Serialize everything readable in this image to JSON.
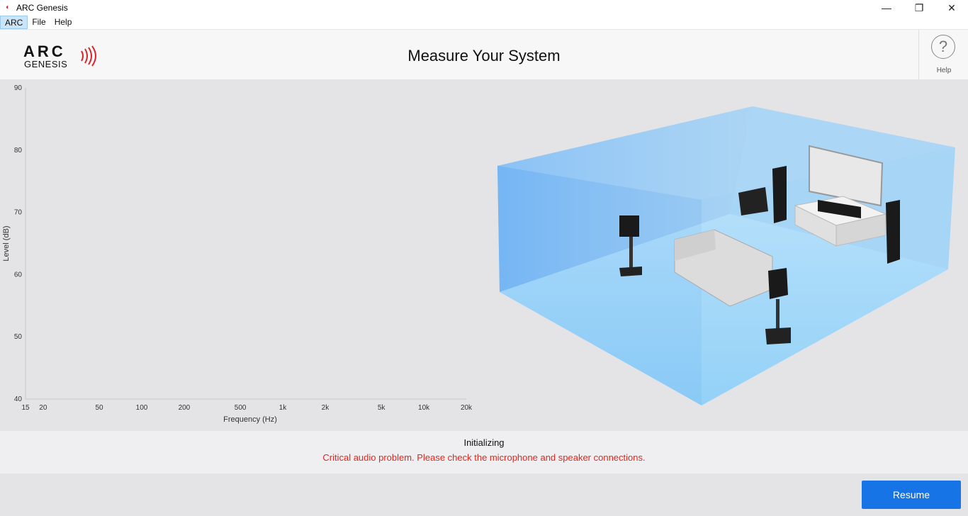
{
  "window": {
    "title": "ARC Genesis",
    "minimize": "—",
    "restore": "❐",
    "close": "✕"
  },
  "menu": {
    "items": [
      "ARC",
      "File",
      "Help"
    ]
  },
  "header": {
    "logo_top": "ARC",
    "logo_bottom": "GENESIS",
    "title": "Measure Your System",
    "help_symbol": "?",
    "help_label": "Help"
  },
  "colors": {
    "accent": "#1774e6",
    "error": "#e0261e",
    "room": "#6fb8f5"
  },
  "chart_data": {
    "type": "line",
    "title": "",
    "xlabel": "Frequency (Hz)",
    "ylabel": "Level (dB)",
    "xscale": "log",
    "xlim": [
      15,
      20000
    ],
    "ylim": [
      40,
      90
    ],
    "xticks": [
      15,
      20,
      50,
      100,
      200,
      500,
      1000,
      2000,
      5000,
      10000,
      20000
    ],
    "xtick_labels": [
      "15",
      "20",
      "50",
      "100",
      "200",
      "500",
      "1k",
      "2k",
      "5k",
      "10k",
      "20k"
    ],
    "yticks": [
      40,
      50,
      60,
      70,
      80,
      90
    ],
    "ytick_labels": [
      "40",
      "50",
      "60",
      "70",
      "80",
      "90"
    ],
    "grid": false,
    "series": []
  },
  "status": {
    "state": "Initializing",
    "error": "Critical audio problem. Please check the microphone and speaker connections."
  },
  "footer": {
    "resume_label": "Resume"
  }
}
